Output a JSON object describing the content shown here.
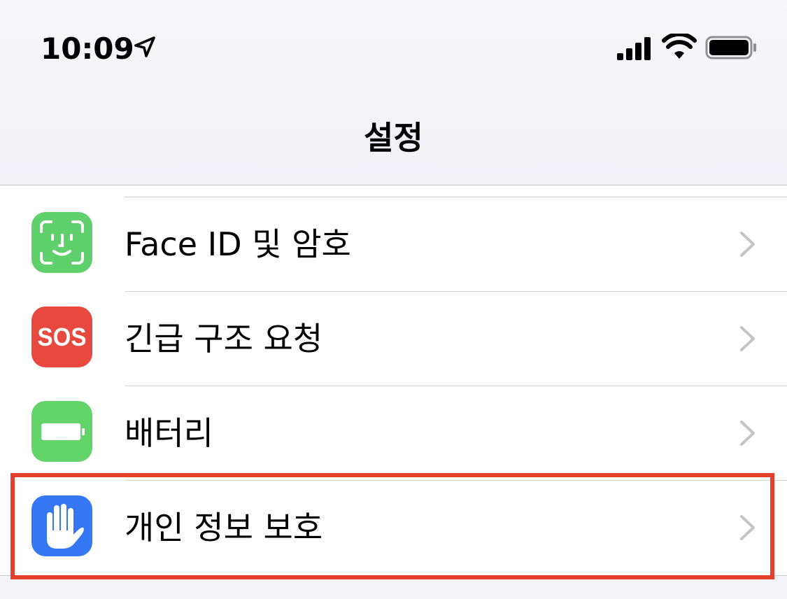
{
  "status_bar": {
    "time": "10:09",
    "location_icon": "location-arrow-icon",
    "signal_icon": "cellular-signal-icon",
    "wifi_icon": "wifi-icon",
    "battery_icon": "battery-icon"
  },
  "nav": {
    "title": "설정"
  },
  "settings": {
    "items": [
      {
        "label": "Face ID 및 암호",
        "icon": "face-id-icon",
        "icon_color": "#5fd06b"
      },
      {
        "label": "긴급 구조 요청",
        "icon": "sos-icon",
        "icon_text": "SOS",
        "icon_color": "#e8493f"
      },
      {
        "label": "배터리",
        "icon": "battery-app-icon",
        "icon_color": "#63d46a"
      },
      {
        "label": "개인 정보 보호",
        "icon": "privacy-hand-icon",
        "icon_color": "#3478f6"
      }
    ]
  },
  "colors": {
    "highlight": "#e4402b",
    "chevron": "#c4c4c7"
  }
}
